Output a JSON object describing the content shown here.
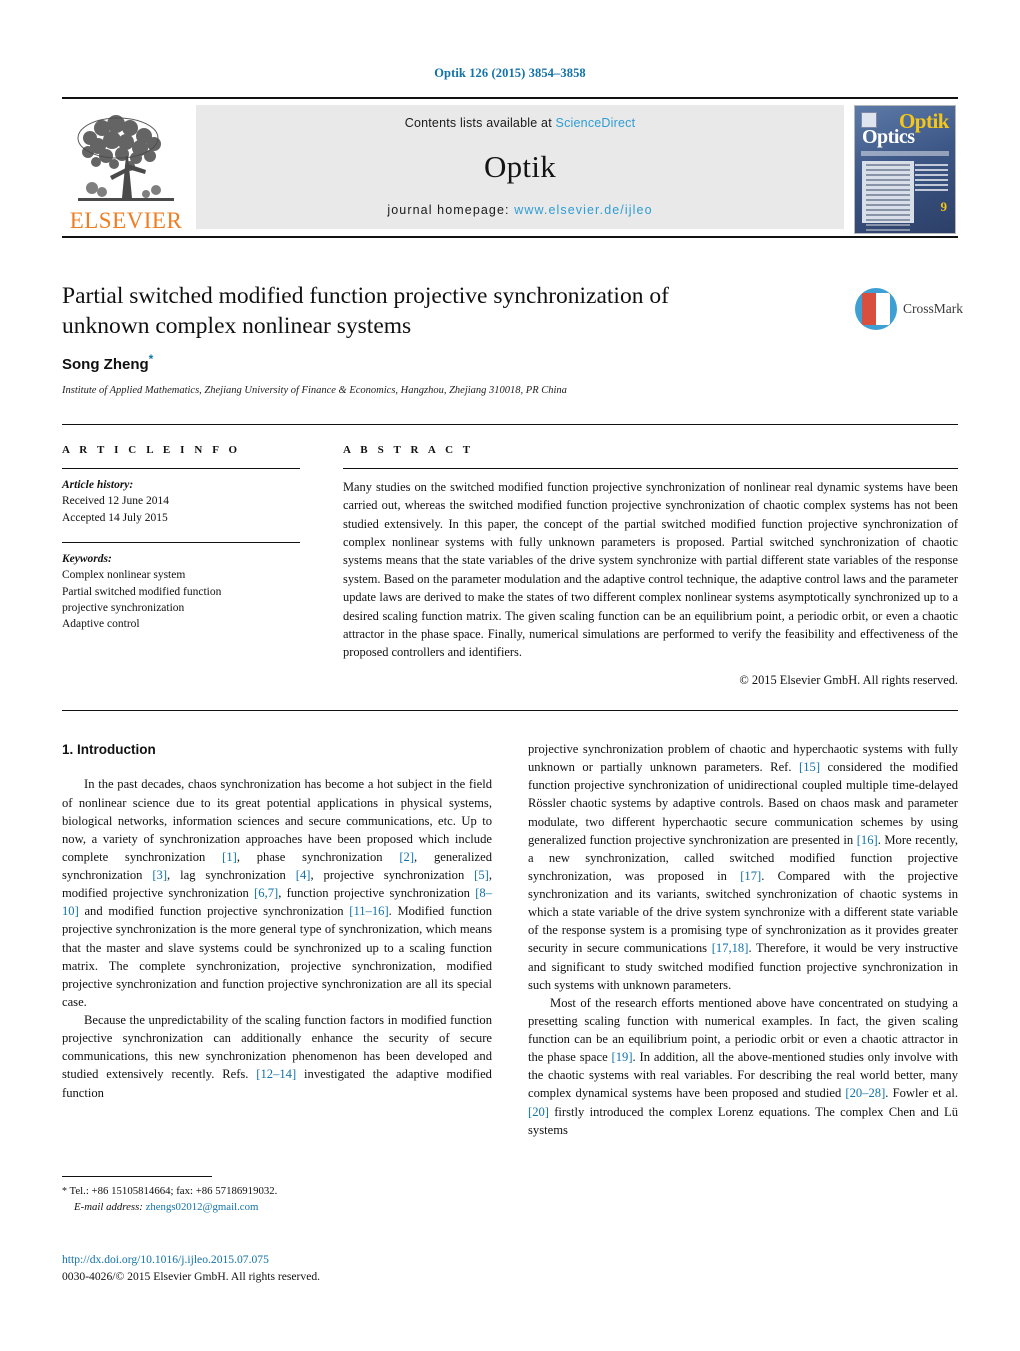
{
  "running_head": "Optik 126 (2015) 3854–3858",
  "masthead": {
    "contents_prefix": "Contents lists available at ",
    "sciencedirect": "ScienceDirect",
    "journal_title": "Optik",
    "homepage_prefix": "journal homepage:",
    "homepage_url": "www.elsevier.de/ijleo",
    "publisher_wordmark": "ELSEVIER",
    "cover": {
      "title_top": "Optik",
      "title_bottom": "Optics",
      "issue_number": "9"
    },
    "accent_link_color": "#2e9dd4",
    "elsevier_orange": "#ef7d22"
  },
  "article": {
    "title": "Partial switched modified function projective synchronization of unknown complex nonlinear systems",
    "author": "Song Zheng",
    "author_footnote_marker": "*",
    "affiliation": "Institute of Applied Mathematics, Zhejiang University of Finance & Economics, Hangzhou, Zhejiang 310018, PR China",
    "crossmark_label": "CrossMark"
  },
  "article_info": {
    "heading": "A R T I C L E    I N F O",
    "history_label": "Article history:",
    "received": "Received 12 June 2014",
    "accepted": "Accepted 14 July 2015",
    "keywords_label": "Keywords:",
    "keywords": [
      "Complex nonlinear system",
      "Partial switched modified function",
      "projective synchronization",
      "Adaptive control"
    ]
  },
  "abstract": {
    "heading": "A B S T R A C T",
    "text": "Many studies on the switched modified function projective synchronization of nonlinear real dynamic systems have been carried out, whereas the switched modified function projective synchronization of chaotic complex systems has not been studied extensively. In this paper, the concept of the partial switched modified function projective synchronization of complex nonlinear systems with fully unknown parameters is proposed. Partial switched synchronization of chaotic systems means that the state variables of the drive system synchronize with partial different state variables of the response system. Based on the parameter modulation and the adaptive control technique, the adaptive control laws and the parameter update laws are derived to make the states of two different complex nonlinear systems asymptotically synchronized up to a desired scaling function matrix. The given scaling function can be an equilibrium point, a periodic orbit, or even a chaotic attractor in the phase space. Finally, numerical simulations are performed to verify the feasibility and effectiveness of the proposed controllers and identifiers.",
    "copyright": "© 2015 Elsevier GmbH. All rights reserved."
  },
  "body": {
    "section_heading": "1.  Introduction",
    "left": {
      "p1_a": "In the past decades, chaos synchronization has become a hot subject in the field of nonlinear science due to its great potential applications in physical systems, biological networks, information sciences and secure communications, etc. Up to now, a variety of synchronization approaches have been proposed which include complete synchronization ",
      "r1": "[1]",
      "p1_b": ", phase synchronization ",
      "r2": "[2]",
      "p1_c": ", generalized synchronization ",
      "r3": "[3]",
      "p1_d": ", lag synchronization ",
      "r4": "[4]",
      "p1_e": ", projective synchronization ",
      "r5": "[5]",
      "p1_f": ", modified projective synchronization ",
      "r67": "[6,7]",
      "p1_g": ", function projective synchronization ",
      "r810": "[8–10]",
      "p1_h": " and modified function projective synchronization ",
      "r1116": "[11–16]",
      "p1_i": ". Modified function projective synchronization is the more general type of synchronization, which means that the master and slave systems could be synchronized up to a scaling function matrix. The complete synchronization, projective synchronization, modified projective synchronization and function projective synchronization are all its special case.",
      "p2_a": "Because the unpredictability of the scaling function factors in modified function projective synchronization can additionally enhance the security of secure communications, this new synchronization phenomenon has been developed and studied extensively recently. Refs. ",
      "r1214": "[12–14]",
      "p2_b": " investigated the adaptive modified function"
    },
    "right": {
      "p1_a": "projective synchronization problem of chaotic and hyperchaotic systems with fully unknown or partially unknown parameters. Ref. ",
      "r15": "[15]",
      "p1_b": " considered the modified function projective synchronization of unidirectional coupled multiple time-delayed Rössler chaotic systems by adaptive controls. Based on chaos mask and parameter modulate, two different hyperchaotic secure communication schemes by using generalized function projective synchronization are presented in ",
      "r16": "[16]",
      "p1_c": ". More recently, a new synchronization, called switched modified function projective synchronization, was proposed in ",
      "r17": "[17]",
      "p1_d": ". Compared with the projective synchronization and its variants, switched synchronization of chaotic systems in which a state variable of the drive system synchronize with a different state variable of the response system is a promising type of synchronization as it provides greater security in secure communications ",
      "r1718": "[17,18]",
      "p1_e": ". Therefore, it would be very instructive and significant to study switched modified function projective synchronization in such systems with unknown parameters.",
      "p2_a": "Most of the research efforts mentioned above have concentrated on studying a presetting scaling function with numerical examples. In fact, the given scaling function can be an equilibrium point, a periodic orbit or even a chaotic attractor in the phase space ",
      "r19": "[19]",
      "p2_b": ". In addition, all the above-mentioned studies only involve with the chaotic systems with real variables. For describing the real world better, many complex dynamical systems have been proposed and studied ",
      "r2028": "[20–28]",
      "p2_c": ". Fowler et al. ",
      "r20": "[20]",
      "p2_d": " firstly introduced the complex Lorenz equations. The complex Chen and Lü systems"
    }
  },
  "footer": {
    "footnote_marker": "*",
    "tel_fax": "Tel.: +86 15105814664; fax: +86 57186919032.",
    "email_label": "E-mail address:",
    "email": "zhengs02012@gmail.com",
    "doi_url": "http://dx.doi.org/10.1016/j.ijleo.2015.07.075",
    "issn_line": "0030-4026/© 2015 Elsevier GmbH. All rights reserved."
  }
}
